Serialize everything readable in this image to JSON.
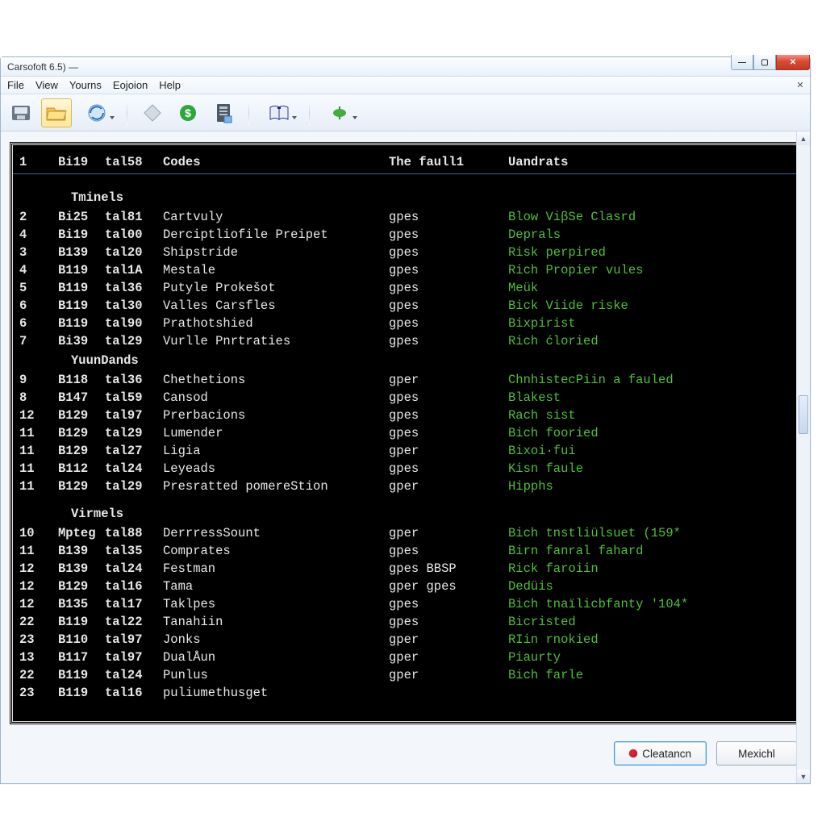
{
  "window": {
    "title": "Carsofoft 6.5)  —"
  },
  "menu": {
    "file": "File",
    "view": "View",
    "yourns": "Yourns",
    "eojoion": "Eojoion",
    "help": "Help"
  },
  "headers": {
    "n": "1",
    "b": "Bi19",
    "t": "tal58",
    "codes": "Codes",
    "fault": "The faull1",
    "uandrats": "Uandrats"
  },
  "sections": {
    "s1": "Tminels",
    "s2": "YuunDands",
    "s3": "Virmels"
  },
  "rows1": [
    {
      "n": "2",
      "b": "Bi25",
      "t": "tal81",
      "code": "Cartvuly",
      "f": "gpes",
      "u": "Blow ViβSe Clasrd"
    },
    {
      "n": "4",
      "b": "Bi19",
      "t": "tal00",
      "code": "Derciptliofile Preipet",
      "f": "gpes",
      "u": "Deprals"
    },
    {
      "n": "3",
      "b": "B139",
      "t": "tal20",
      "code": "Shipstride",
      "f": "gpes",
      "u": "Risk perpired"
    },
    {
      "n": "4",
      "b": "B119",
      "t": "tal1A",
      "code": "Mestale",
      "f": "gpes",
      "u": "Rich Propier vules"
    },
    {
      "n": "5",
      "b": "B119",
      "t": "tal36",
      "code": "Putyle Prokešot",
      "f": "gpes",
      "u": "Meük"
    },
    {
      "n": "6",
      "b": "B119",
      "t": "tal30",
      "code": "Valles Carsfles",
      "f": "gpes",
      "u": "Bick Viide riske"
    },
    {
      "n": "6",
      "b": "B119",
      "t": "tal90",
      "code": "Prathotshied",
      "f": "gpes",
      "u": "Bixpirist"
    },
    {
      "n": "7",
      "b": "Bi39",
      "t": "tal29",
      "code": "Vurlle Pnrtraties",
      "f": "gpes",
      "u": "Rich ćloried"
    }
  ],
  "rows2": [
    {
      "n": "9",
      "b": "B118",
      "t": "tal36",
      "code": "Chethetions",
      "f": "gper",
      "u": "ChnhistecPiin a fauled"
    },
    {
      "n": "8",
      "b": "B147",
      "t": "tal59",
      "code": "Cansod",
      "f": "gpes",
      "u": "Blakest"
    },
    {
      "n": "12",
      "b": "B129",
      "t": "tal97",
      "code": "Prerbacions",
      "f": "gpes",
      "u": "Rach sist"
    },
    {
      "n": "11",
      "b": "B129",
      "t": "tal29",
      "code": "Lumender",
      "f": "gpes",
      "u": "Bich fooried"
    },
    {
      "n": "11",
      "b": "B129",
      "t": "tal27",
      "code": "Ligia",
      "f": "gper",
      "u": "Bixoi·fui"
    },
    {
      "n": "11",
      "b": "B112",
      "t": "tal24",
      "code": "Leyeads",
      "f": "gpes",
      "u": "Kisn faule"
    },
    {
      "n": "11",
      "b": "B129",
      "t": "tal29",
      "code": "Presratted pomereStion",
      "f": "gper",
      "u": "Hipphs"
    }
  ],
  "rows3": [
    {
      "n": "10",
      "b": "Mpteg",
      "t": "tal88",
      "code": "DerrressSount",
      "f": "gper",
      "u": "Bich tnstliülsuet (159*"
    },
    {
      "n": "11",
      "b": "B139",
      "t": "tal35",
      "code": "Comprates",
      "f": "gpes",
      "u": "Birn fanral fahard"
    },
    {
      "n": "12",
      "b": "B139",
      "t": "tal24",
      "code": "Festman",
      "f": "gpes BBSP",
      "u": "Rick faroiin"
    },
    {
      "n": "12",
      "b": "B129",
      "t": "tal16",
      "code": "Tama",
      "f": "gper gpes",
      "u": "Dedüis"
    },
    {
      "n": "12",
      "b": "B135",
      "t": "tal17",
      "code": "Taklpes",
      "f": "gpes",
      "u": "Bich tnaïlicbfanty '104*"
    },
    {
      "n": "22",
      "b": "B119",
      "t": "tal22",
      "code": "Tanahiin",
      "f": "gpes",
      "u": "Bicristed"
    },
    {
      "n": "23",
      "b": "B110",
      "t": "tal97",
      "code": "Jonks",
      "f": "gper",
      "u": "RIin rnokied"
    },
    {
      "n": "13",
      "b": "B117",
      "t": "tal97",
      "code": "DualÅun",
      "f": "gper",
      "u": "Piaurty"
    },
    {
      "n": "22",
      "b": "B119",
      "t": "tal24",
      "code": "Punlus",
      "f": "gper",
      "u": "Bich farle"
    },
    {
      "n": "23",
      "b": "B119",
      "t": "tal16",
      "code": "puliumethusget",
      "f": "",
      "u": ""
    }
  ],
  "buttons": {
    "clear": "Cleatancn",
    "mex": "Mexichl"
  }
}
